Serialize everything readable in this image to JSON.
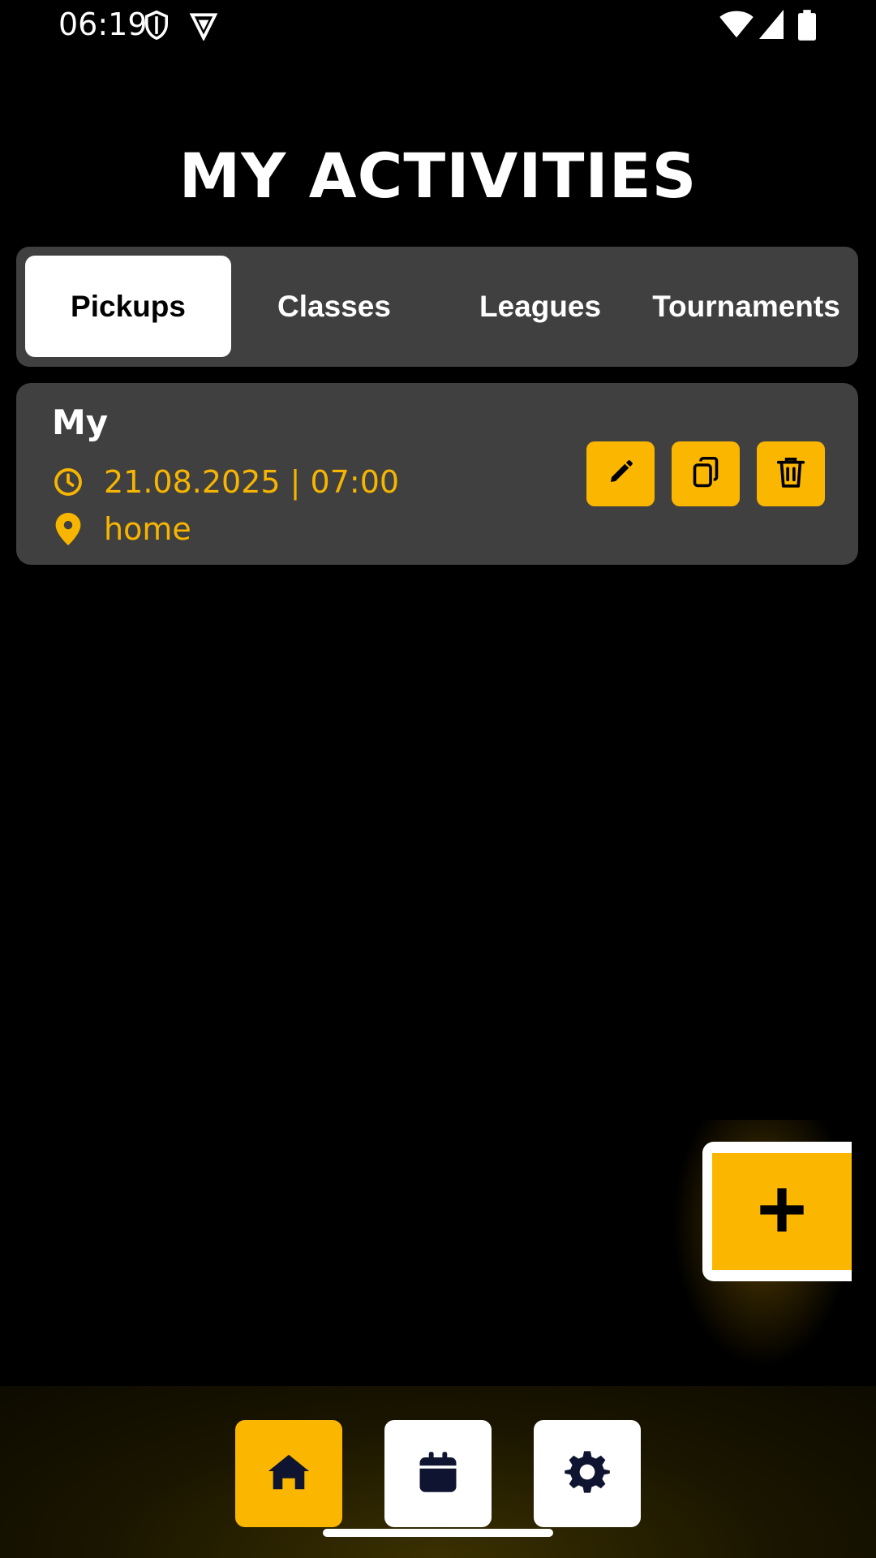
{
  "status_bar": {
    "time": "06:19"
  },
  "page": {
    "title": "MY ACTIVITIES"
  },
  "tabs": [
    {
      "label": "Pickups",
      "active": true
    },
    {
      "label": "Classes",
      "active": false
    },
    {
      "label": "Leagues",
      "active": false
    },
    {
      "label": "Tournaments",
      "active": false
    }
  ],
  "activities": [
    {
      "title": "My",
      "datetime": "21.08.2025 | 07:00",
      "location": "home"
    }
  ],
  "actions": {
    "edit_icon": "pencil-icon",
    "copy_icon": "copy-icon",
    "delete_icon": "trash-icon"
  },
  "fab": {
    "icon": "plus-icon"
  },
  "bottom_nav": [
    {
      "icon": "home-icon",
      "active": true
    },
    {
      "icon": "calendar-icon",
      "active": false
    },
    {
      "icon": "gear-icon",
      "active": false
    }
  ],
  "colors": {
    "accent": "#fbb600",
    "card_bg": "#404040",
    "background": "#000000"
  }
}
